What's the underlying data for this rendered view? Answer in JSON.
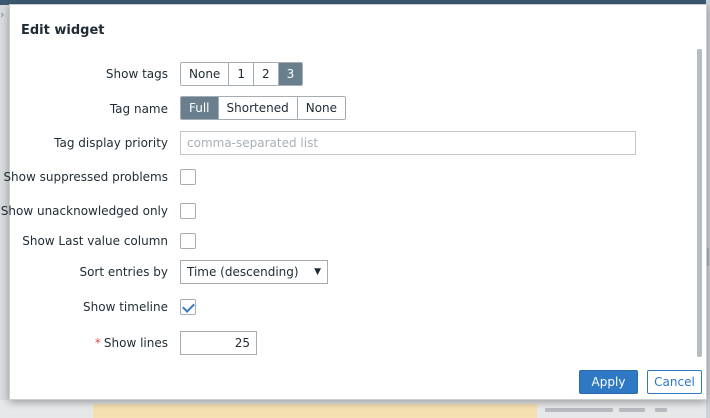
{
  "dialog": {
    "title": "Edit widget",
    "close_glyph": "×"
  },
  "fields": {
    "show_tags": {
      "label": "Show tags",
      "options": [
        "None",
        "1",
        "2",
        "3"
      ],
      "selected": "3"
    },
    "tag_name": {
      "label": "Tag name",
      "options": [
        "Full",
        "Shortened",
        "None"
      ],
      "selected": "Full"
    },
    "tag_display_priority": {
      "label": "Tag display priority",
      "value": "",
      "placeholder": "comma-separated list"
    },
    "show_suppressed": {
      "label": "Show suppressed problems",
      "checked": false
    },
    "show_unacknowledged": {
      "label": "Show unacknowledged only",
      "checked": false
    },
    "show_last_value": {
      "label": "Show Last value column",
      "checked": false
    },
    "sort_entries": {
      "label": "Sort entries by",
      "value": "Time (descending)",
      "caret": "▼"
    },
    "show_timeline": {
      "label": "Show timeline",
      "checked": true
    },
    "show_lines": {
      "label": "Show lines",
      "required_mark": "*",
      "value": "25"
    }
  },
  "buttons": {
    "apply": "Apply",
    "cancel": "Cancel"
  },
  "colors": {
    "primary": "#2f78c4",
    "segment_active": "#6a7f8e",
    "required": "#d64e4e"
  }
}
